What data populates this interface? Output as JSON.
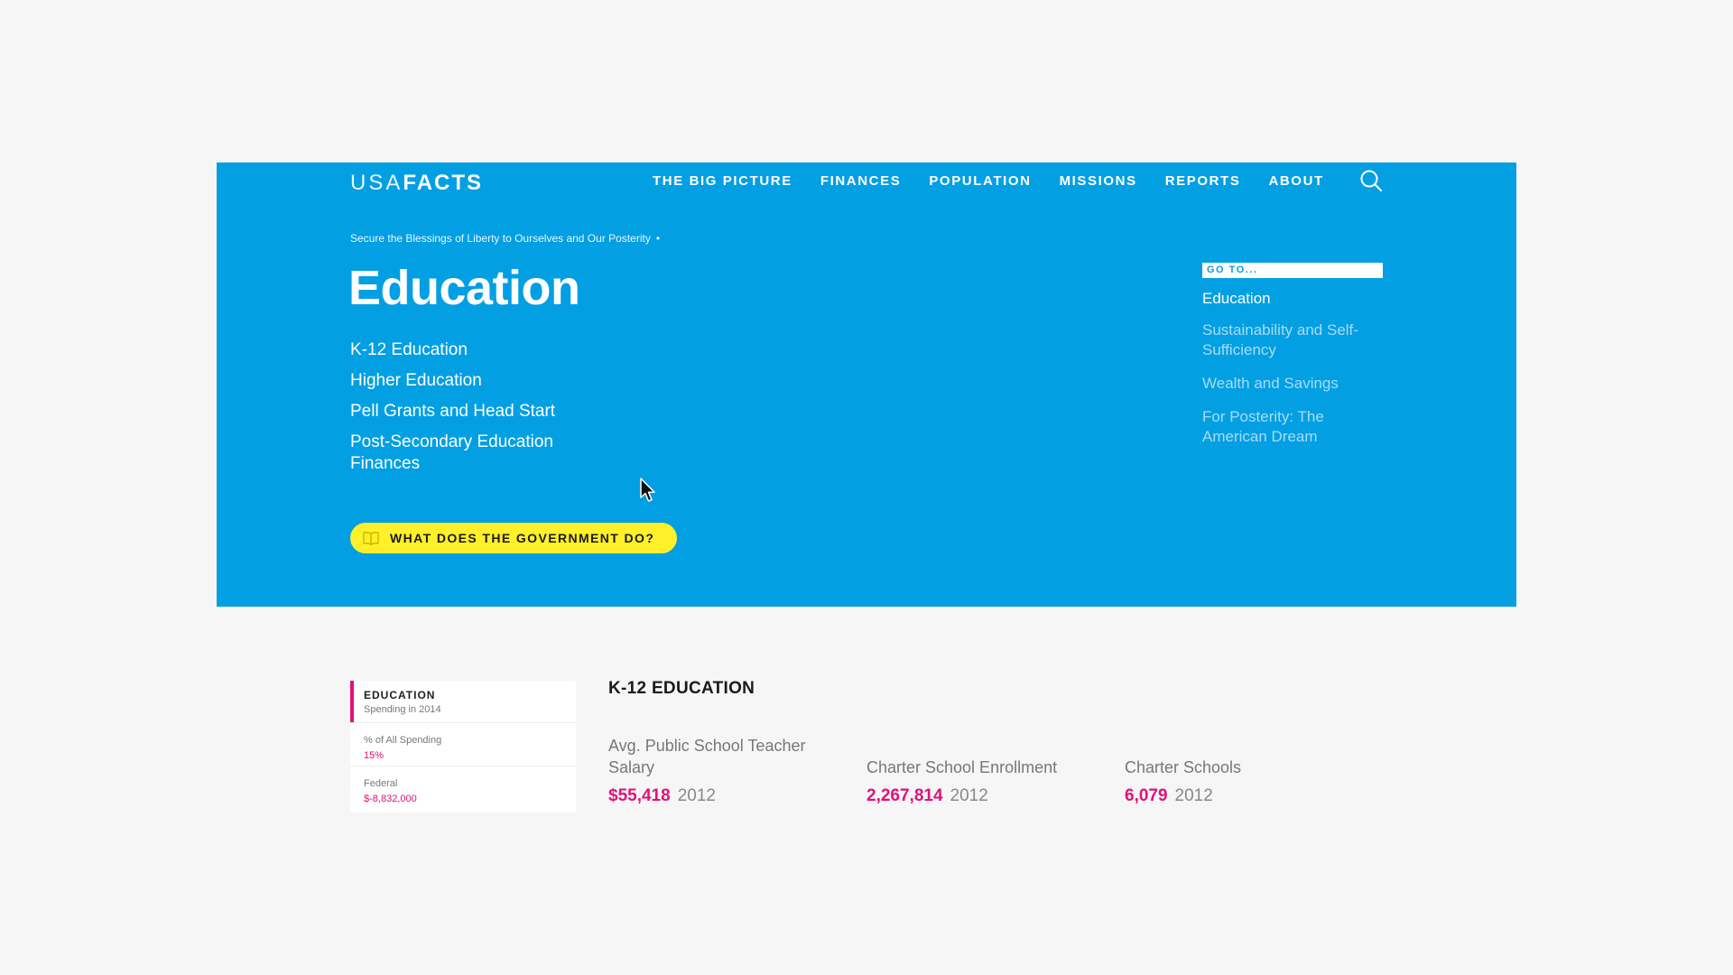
{
  "brand": {
    "logo_usa": "USA",
    "logo_facts": "FACTS"
  },
  "nav": {
    "items": [
      "THE BIG PICTURE",
      "FINANCES",
      "POPULATION",
      "MISSIONS",
      "REPORTS",
      "ABOUT"
    ]
  },
  "hero": {
    "breadcrumb": "Secure the Blessings of Liberty to Ourselves and Our Posterity",
    "breadcrumb_sep": "•",
    "title": "Education",
    "subnav": [
      "K-12 Education",
      "Higher Education",
      "Pell Grants and Head Start",
      "Post-Secondary Education Finances"
    ],
    "cta_label": "WHAT DOES THE GOVERNMENT DO?"
  },
  "goto": {
    "label": "GO TO...",
    "items": [
      "Education",
      "Sustainability and Self-Sufficiency",
      "Wealth and Savings",
      "For Posterity: The American Dream"
    ]
  },
  "summary": {
    "title": "EDUCATION",
    "subtitle": "Spending in 2014",
    "pct_label": "% of All Spending",
    "pct_value": "15%",
    "federal_label": "Federal",
    "federal_value": "$-8,832,000"
  },
  "section": {
    "title": "K-12 EDUCATION",
    "stats": [
      {
        "label": "Avg. Public School Teacher Salary",
        "value": "$55,418",
        "year": "2012"
      },
      {
        "label": "Charter School Enrollment",
        "value": "2,267,814",
        "year": "2012"
      },
      {
        "label": "Charter Schools",
        "value": "6,079",
        "year": "2012"
      }
    ]
  },
  "colors": {
    "hero_blue": "#029fe3",
    "cta_yellow": "#fff02a",
    "accent_magenta": "#e2117a",
    "background": "#f6f6f6"
  },
  "icons": {
    "search": "search-icon",
    "cta": "book-icon",
    "cursor": "mouse-cursor-icon"
  }
}
